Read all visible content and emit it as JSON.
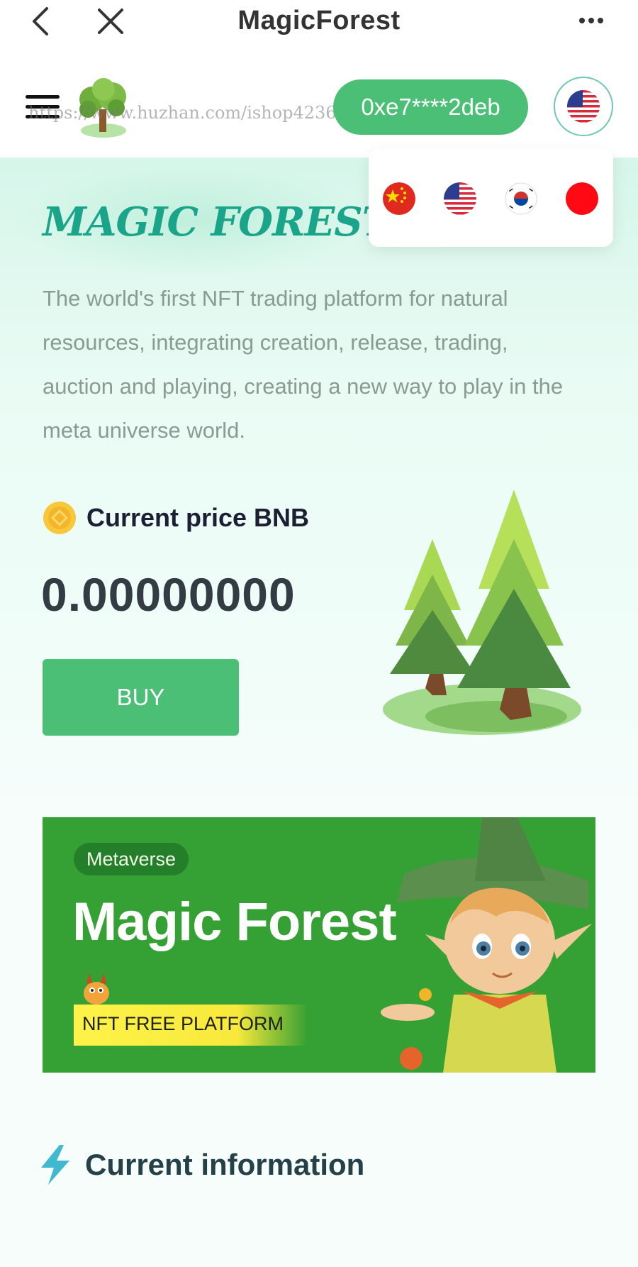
{
  "titlebar": {
    "title": "MagicForest"
  },
  "header": {
    "watermark": "https://www.huzhan.com/ishop42366",
    "wallet_address": "0xe7****2deb",
    "current_language_flag": "us-flag-icon"
  },
  "language_menu": {
    "options": [
      "china-flag-icon",
      "us-flag-icon",
      "korea-flag-icon",
      "japan-flag-icon"
    ]
  },
  "hero": {
    "title": "MAGIC FOREST",
    "description": "The world's first NFT trading platform for natural resources, integrating creation, release, trading, auction and playing, creating a new way to play in the meta universe world.",
    "price_label": "Current price BNB",
    "price_value": "0.00000000",
    "buy_label": "BUY"
  },
  "banner": {
    "pill": "Metaverse",
    "title": "Magic Forest",
    "strip": "NFT FREE PLATFORM"
  },
  "section": {
    "current_information": "Current information"
  },
  "colors": {
    "accent_green": "#4cbf77",
    "title_teal": "#1aa48a",
    "banner_green": "#35a033"
  }
}
